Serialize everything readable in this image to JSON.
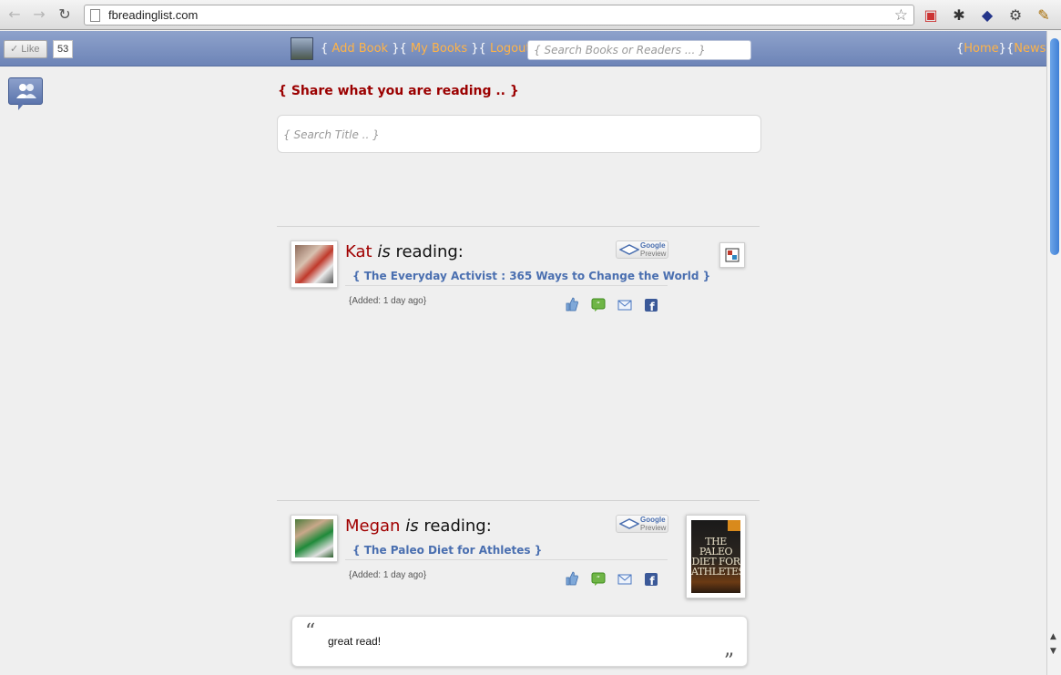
{
  "browser": {
    "url": "fbreadinglist.com"
  },
  "topbar": {
    "like_label": "✓ Like",
    "like_count": "53",
    "brace_open": "{",
    "brace_close": "}",
    "add_book": "Add Book",
    "my_books": "My Books",
    "logout": "Logout",
    "search_placeholder": "{ Search Books or Readers ... }",
    "home": "Home",
    "news": "News"
  },
  "main": {
    "share_title": "{ Share what you are reading .. }",
    "title_search_placeholder": "{ Search Title .. }"
  },
  "feed": [
    {
      "name": "Kat",
      "is_word": "is",
      "reading_word": "reading:",
      "book": "{ The Everyday Activist : 365 Ways to Change the World }",
      "added": "{Added: 1 day ago}",
      "preview_top": "Google",
      "preview_bottom": "Preview"
    },
    {
      "name": "Megan",
      "is_word": "is",
      "reading_word": "reading:",
      "book": "{ The Paleo Diet for Athletes }",
      "added": "{Added: 1 day ago}",
      "preview_top": "Google",
      "preview_bottom": "Preview",
      "cover_title": "THE PALEO DIET FOR ATHLETES",
      "comment": "great read!"
    }
  ],
  "icons": [
    "back-icon",
    "forward-icon",
    "reload-icon",
    "star-icon",
    "like-icon",
    "comment-icon",
    "mail-icon",
    "facebook-icon",
    "friends-icon"
  ],
  "colors": {
    "site_bar": "#6d84b7",
    "link_orange": "#ffb347",
    "name_red": "#a00000",
    "book_blue": "#4a6fb0"
  }
}
